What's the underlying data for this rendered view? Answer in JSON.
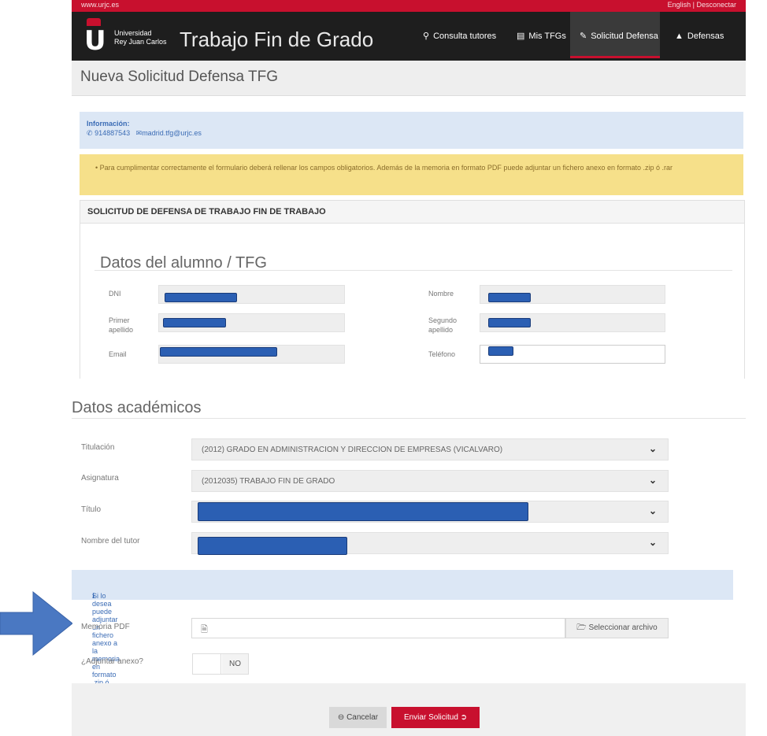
{
  "topbar": {
    "left_text": "www.urjc.es",
    "right_text": "English  |  Desconectar"
  },
  "header": {
    "university_line1": "Universidad",
    "university_line2": "Rey Juan Carlos",
    "app_title": "Trabajo Fin de Grado",
    "nav": [
      {
        "label": "Consulta tutores",
        "icon": "search-icon"
      },
      {
        "label": "Mis TFGs",
        "icon": "document-icon"
      },
      {
        "label": "Solicitud Defensa",
        "icon": "pencil-icon",
        "active": true
      },
      {
        "label": "Defensas",
        "icon": "institution-icon"
      }
    ]
  },
  "page_title": "Nueva Solicitud Defensa TFG",
  "info": {
    "title": "Información:",
    "phone": "914887543",
    "email": "madrid.tfg@urjc.es"
  },
  "warning": "Para cumplimentar correctamente el formulario deberá rellenar los campos obligatorios. Además de la memoria en formato PDF puede adjuntar un fichero anexo en formato .zip ó .rar",
  "form_panel_title": "SOLICITUD DE DEFENSA DE TRABAJO FIN DE TRABAJO",
  "student": {
    "section_title": "Datos del alumno / TFG",
    "dni_label": "DNI",
    "nombre_label": "Nombre",
    "primer_label": "Primer apellido",
    "segundo_label": "Segundo apellido",
    "email_label": "Email",
    "telefono_label": "Teléfono"
  },
  "academic": {
    "section_title": "Datos académicos",
    "titulacion_label": "Titulación",
    "titulacion_value": "(2012) GRADO EN ADMINISTRACION Y DIRECCION DE EMPRESAS (VICALVARO)",
    "asignatura_label": "Asignatura",
    "asignatura_value": "(2012035) TRABAJO FIN DE GRADO",
    "titulo_label": "Título",
    "tutor_label": "Nombre del tutor"
  },
  "attach_info": "Si lo desea puede adjuntar un fichero anexo a la memoria en formato .zip ó .rar.",
  "memoria_label": "Memoria PDF",
  "select_file_label": "Seleccionar archivo",
  "anexo_label": "¿Adjuntar anexo?",
  "anexo_toggle": "NO",
  "buttons": {
    "cancel": "Cancelar",
    "send": "Enviar Solicitud"
  },
  "colors": {
    "brand_red": "#c8102e",
    "header_black": "#1e1e1e",
    "info_blue": "#dce7f5",
    "warning_yellow": "#f6e08a",
    "arrow_blue": "#4a78c2"
  }
}
